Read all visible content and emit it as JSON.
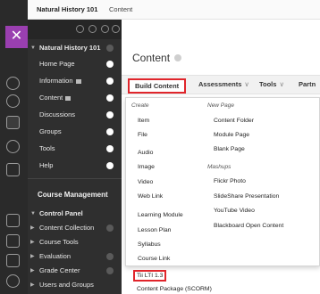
{
  "topbar": {
    "course_title": "Natural History 101",
    "breadcrumb": "Content"
  },
  "course_menu": {
    "course_name": "Natural History 101",
    "items": [
      {
        "label": "Home Page",
        "status": "on"
      },
      {
        "label": "Information",
        "status": "on"
      },
      {
        "label": "Content",
        "status": "on"
      },
      {
        "label": "Discussions",
        "status": "on"
      },
      {
        "label": "Groups",
        "status": "on"
      },
      {
        "label": "Tools",
        "status": "on"
      },
      {
        "label": "Help",
        "status": "on"
      }
    ],
    "management_heading": "Course Management",
    "control_panel": "Control Panel",
    "cp_items": [
      "Content Collection",
      "Course Tools",
      "Evaluation",
      "Grade Center",
      "Users and Groups"
    ]
  },
  "main": {
    "page_title": "Content",
    "toolbar": {
      "build_content": "Build Content",
      "assessments": "Assessments",
      "tools": "Tools",
      "partner": "Partn"
    },
    "dropdown": {
      "create_heading": "Create",
      "new_page_heading": "New Page",
      "mashups_heading": "Mashups",
      "create_items": [
        "Item",
        "File",
        "Audio",
        "Image",
        "Video",
        "Web Link",
        "Learning Module",
        "Lesson Plan",
        "Syllabus",
        "Course Link",
        "Tii LTI 1.3",
        "Content Package (SCORM)"
      ],
      "new_page_items": [
        "Content Folder",
        "Module Page",
        "Blank Page"
      ],
      "mashup_items": [
        "Flickr Photo",
        "SlideShare Presentation",
        "YouTube Video",
        "Blackboard Open Content"
      ]
    }
  },
  "colors": {
    "accent_purple": "#9a3fb0",
    "highlight_red": "#e0252b",
    "menu_dark": "#2f2f2f"
  }
}
